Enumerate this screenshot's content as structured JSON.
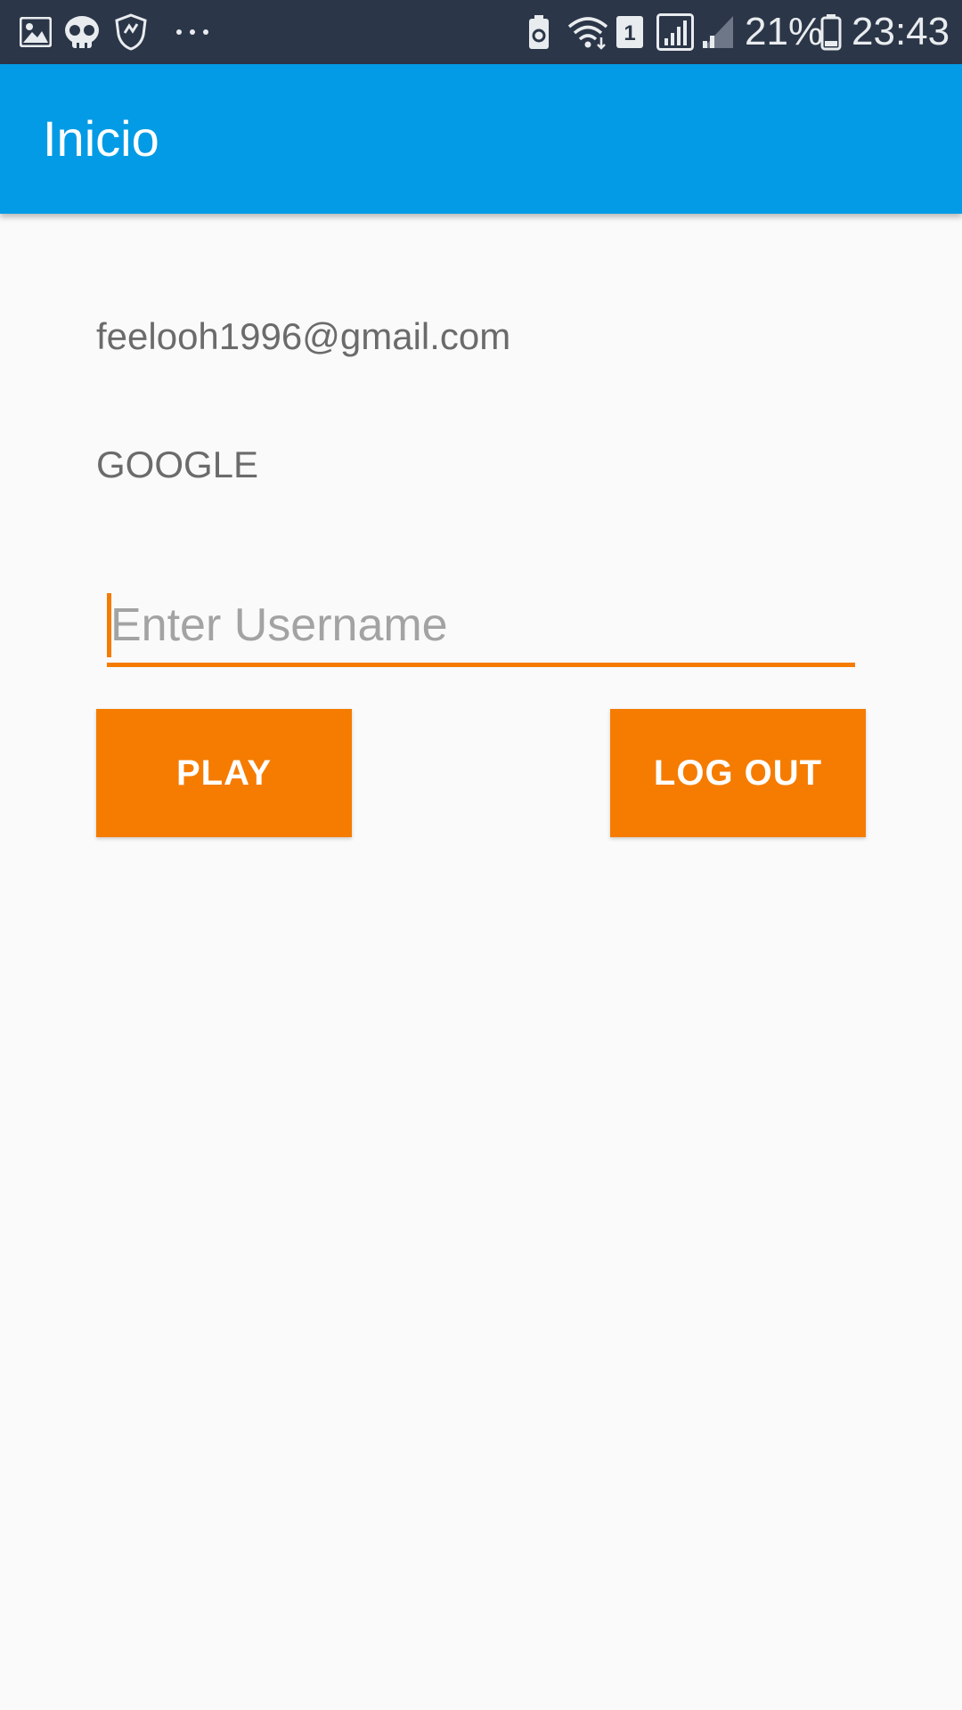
{
  "status_bar": {
    "icons_left": [
      "gallery-icon",
      "skull-icon",
      "shield-icon",
      "more-dots-icon"
    ],
    "icons_right": [
      "battery-saver-icon",
      "wifi-icon",
      "sim-1-icon",
      "signal-icon",
      "signal-weak-icon",
      "battery-icon"
    ],
    "battery_percent": "21%",
    "time": "23:43"
  },
  "app_bar": {
    "title": "Inicio",
    "color": "#039be5"
  },
  "account": {
    "email": "feelooh1996@gmail.com",
    "provider": "GOOGLE"
  },
  "username_input": {
    "placeholder": "Enter Username",
    "value": ""
  },
  "buttons": {
    "play_label": "PLAY",
    "logout_label": "LOG OUT",
    "color": "#f57c00"
  },
  "colors": {
    "status_bar": "#2b3648",
    "background": "#fafafa",
    "accent": "#f57c00"
  }
}
